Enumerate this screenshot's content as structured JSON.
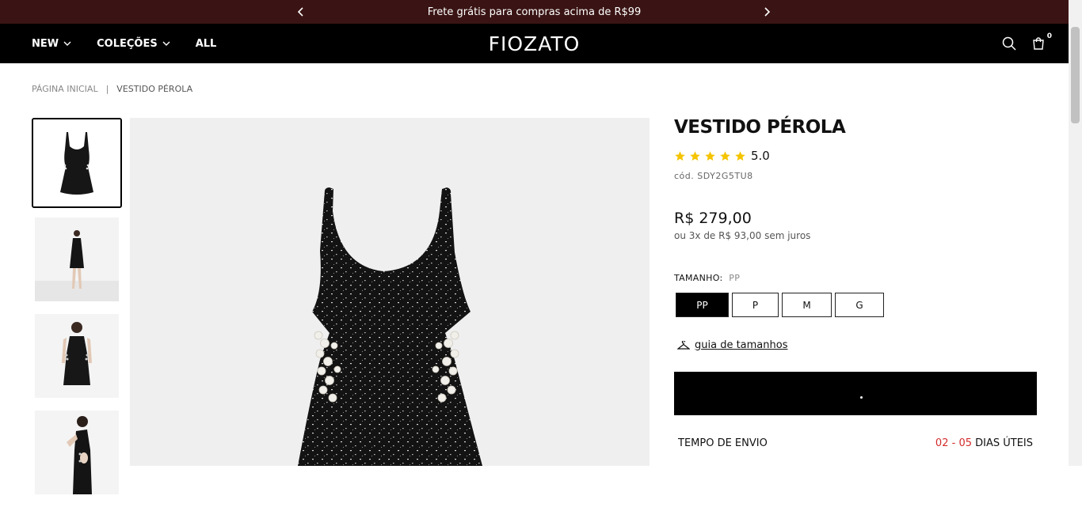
{
  "announcement": {
    "text": "Frete grátis para compras acima de R$99"
  },
  "nav": {
    "links": [
      {
        "label": "NEW",
        "has_dropdown": true
      },
      {
        "label": "COLEÇÕES",
        "has_dropdown": true
      },
      {
        "label": "ALL",
        "has_dropdown": false
      }
    ],
    "logo": "FIOZATO",
    "cart_count": "0",
    "icons": [
      "search-icon",
      "cart-icon"
    ]
  },
  "breadcrumb": {
    "home": "PÁGINA INICIAL",
    "separator": "|",
    "current": "VESTIDO PÉROLA"
  },
  "product": {
    "title": "VESTIDO PÉROLA",
    "rating": {
      "value": "5.0",
      "stars": 5
    },
    "sku": "cód. SDY2G5TU8",
    "price": "R$ 279,00",
    "installments": "ou 3x de R$ 93,00 sem juros",
    "size_label": "TAMANHO:",
    "selected_size": "PP",
    "sizes": [
      "PP",
      "P",
      "M",
      "G"
    ],
    "size_guide": "guia de tamanhos",
    "shipping": {
      "label": "TEMPO DE ENVIO",
      "from": "02",
      "dash": " - ",
      "to": "05",
      "unit": " DIAS ÚTEIS"
    }
  },
  "colors": {
    "announcement_bg": "#3a1414",
    "nav_bg": "#000000",
    "star": "#f5c400",
    "shipping_days": "#d42b2b"
  }
}
